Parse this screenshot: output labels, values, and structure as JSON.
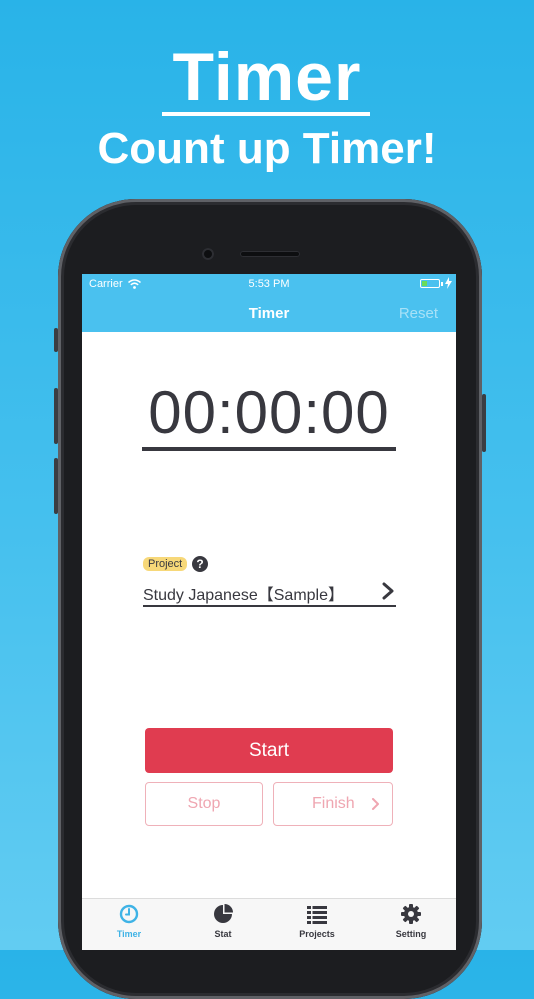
{
  "promo": {
    "title": "Timer",
    "subtitle": "Count up Timer!"
  },
  "status_bar": {
    "carrier": "Carrier",
    "time": "5:53 PM"
  },
  "nav": {
    "title": "Timer",
    "reset_label": "Reset"
  },
  "timer": {
    "display": "00:00:00"
  },
  "project": {
    "badge": "Project",
    "help": "?",
    "name": "Study Japanese【Sample】"
  },
  "actions": {
    "start_label": "Start",
    "stop_label": "Stop",
    "finish_label": "Finish"
  },
  "tabs": [
    {
      "label": "Timer",
      "icon": "clock-icon",
      "active": true
    },
    {
      "label": "Stat",
      "icon": "pie-chart-icon",
      "active": false
    },
    {
      "label": "Projects",
      "icon": "list-icon",
      "active": false
    },
    {
      "label": "Setting",
      "icon": "gear-icon",
      "active": false
    }
  ],
  "colors": {
    "background": "#29b3e8",
    "nav": "#4ac1ef",
    "start": "#e03c50",
    "active_tab": "#3fb3e6",
    "badge": "#f7d879"
  }
}
